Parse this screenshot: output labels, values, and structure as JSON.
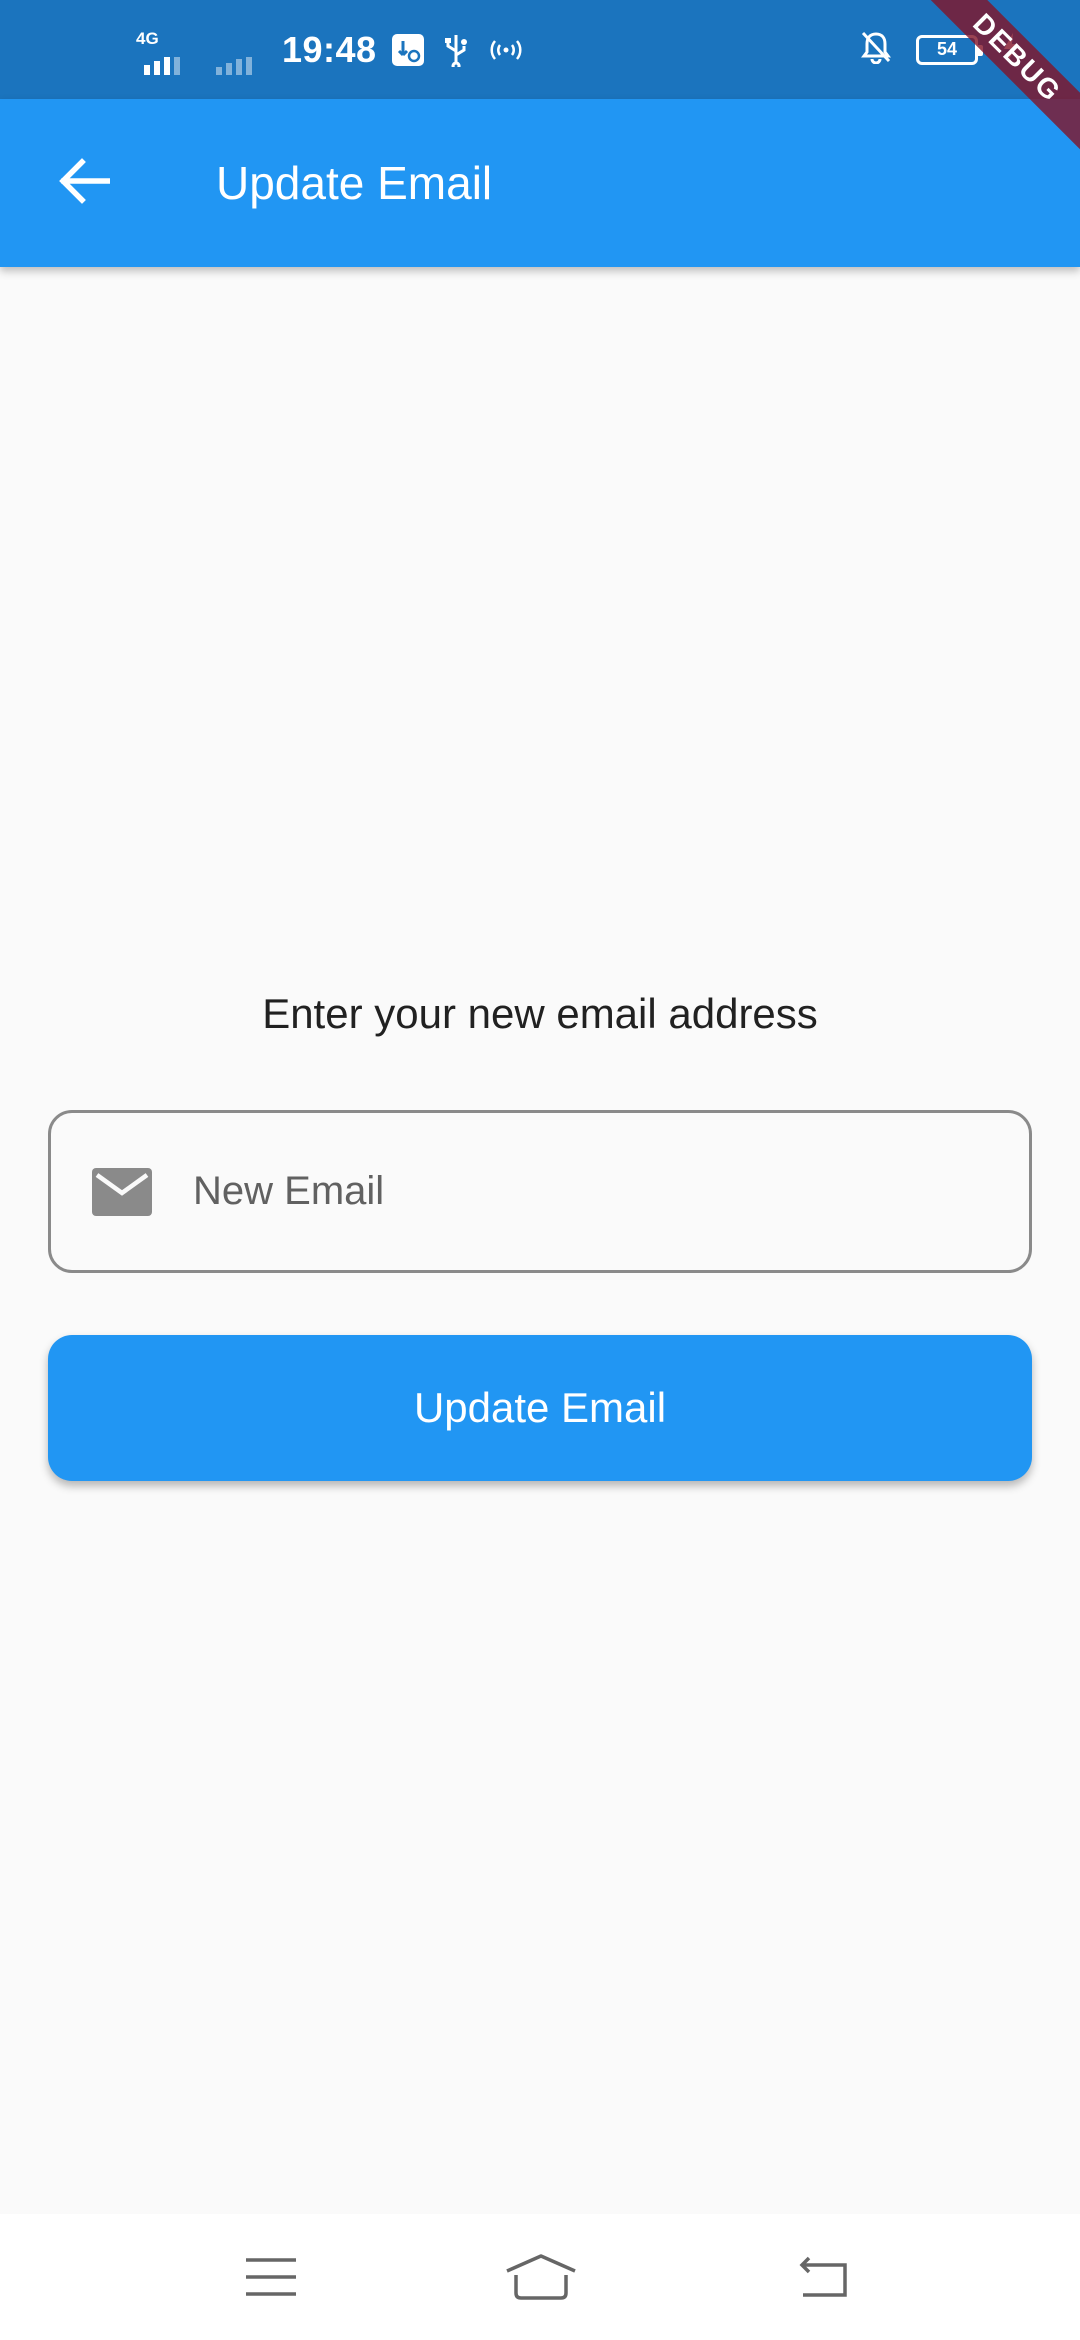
{
  "status_bar": {
    "network_label": "4G",
    "time": "19:48",
    "battery_level": "54",
    "icons": [
      "signal-4g-icon",
      "signal-sim2-icon",
      "usb-settings-icon",
      "usb-icon",
      "hotspot-icon",
      "notifications-off-icon",
      "battery-icon",
      "charging-icon"
    ]
  },
  "debug_banner": "DEBUG",
  "app_bar": {
    "title": "Update Email",
    "back_icon": "arrow-back-icon"
  },
  "form": {
    "prompt": "Enter your new email address",
    "email_placeholder": "New Email",
    "email_value": "",
    "email_icon": "email-icon",
    "submit_label": "Update Email"
  },
  "nav_bar": {
    "icons": [
      "menu-icon",
      "home-icon",
      "back-icon"
    ]
  },
  "colors": {
    "status_bar": "#1b74be",
    "app_bar": "#2196f3",
    "button": "#2196f3",
    "background": "#fafafa"
  }
}
